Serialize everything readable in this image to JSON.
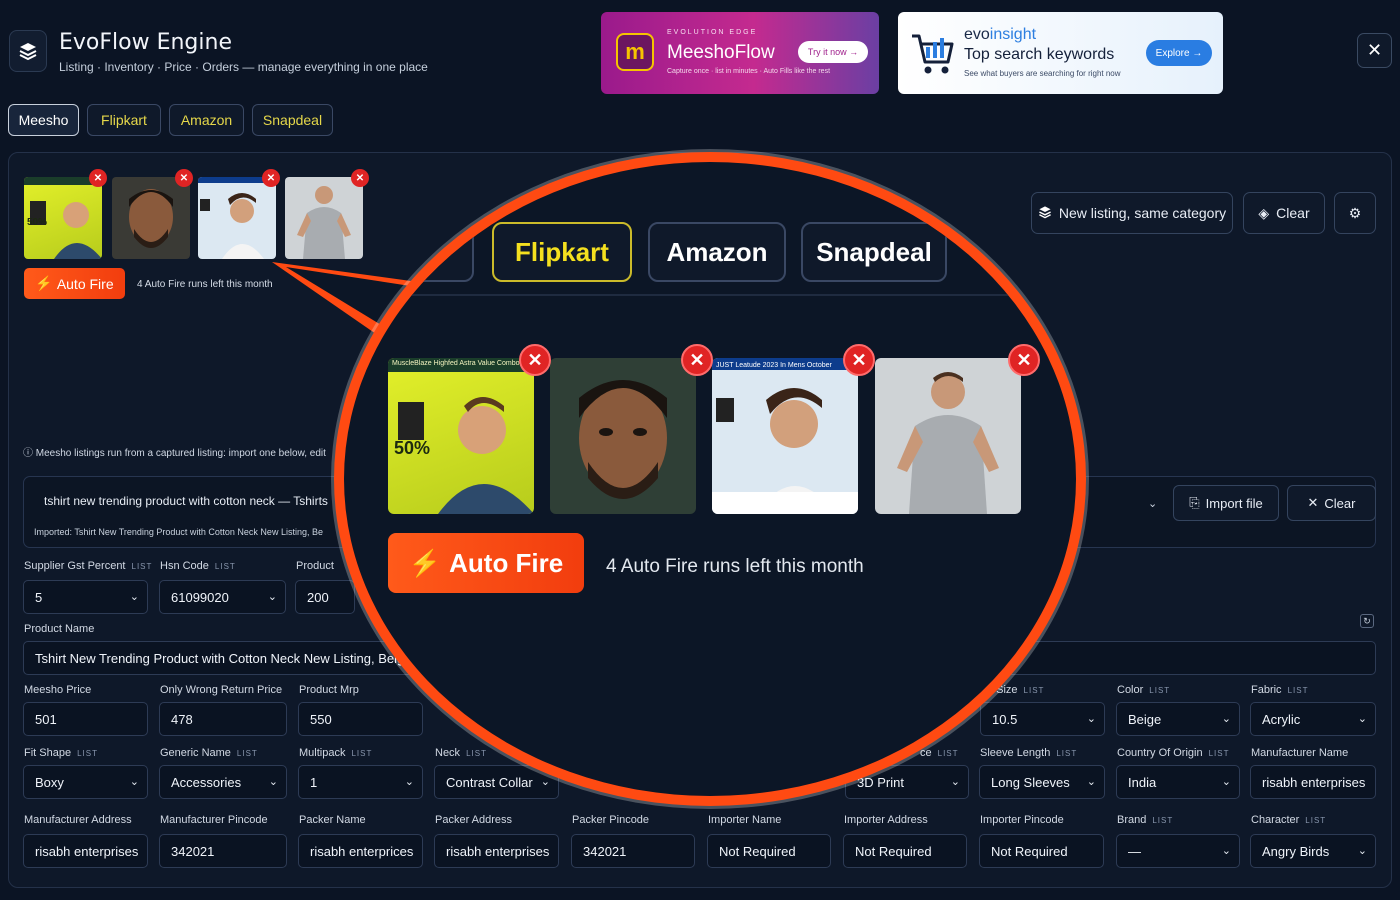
{
  "app": {
    "title": "EvoFlow Engine",
    "subtitle": "Listing · Inventory · Price · Orders — manage everything in one place"
  },
  "ads": [
    {
      "eyebrow": "EVOLUTION EDGE",
      "name": "MeeshoFlow",
      "tagline": "Capture once · list in minutes · Auto Fills like the rest",
      "cta": "Try it now →",
      "logo_letter": "m"
    },
    {
      "brand_a": "evo",
      "brand_b": "insight",
      "name": "Top search keywords",
      "tagline": "See what buyers are searching for right now",
      "cta": "Explore →"
    }
  ],
  "marketplace_tabs": [
    "Meesho",
    "Flipkart",
    "Amazon",
    "Snapdeal"
  ],
  "active_tab": "Meesho",
  "toolbar": {
    "new_listing": "New listing, same category",
    "clear": "Clear"
  },
  "auto_fire": {
    "label": "Auto Fire",
    "note": "4 Auto Fire runs left this month"
  },
  "info_line": "Meesho listings run from a captured listing: import one below, edit",
  "import": {
    "value": "tshirt new trending product with cotton neck — Tshirts",
    "note": "Imported: Tshirt New Trending Product with Cotton Neck New Listing, Be",
    "import_file": "Import file",
    "clear": "Clear"
  },
  "list_tag": "LIST",
  "fields_row1": [
    {
      "label": "Supplier Gst Percent",
      "list": true,
      "value": "5",
      "dropdown": true
    },
    {
      "label": "Hsn Code",
      "list": true,
      "value": "61099020",
      "dropdown": true
    },
    {
      "label": "Product",
      "list": false,
      "value": "200",
      "dropdown": false
    }
  ],
  "product_name": {
    "label": "Product Name",
    "value": "Tshirt New Trending Product with Cotton Neck New Listing, Beige"
  },
  "fields_row2": [
    {
      "label": "Meesho Price",
      "list": false,
      "value": "501",
      "dropdown": false
    },
    {
      "label": "Only Wrong Return Price",
      "list": false,
      "value": "478",
      "dropdown": false
    },
    {
      "label": "Product Mrp",
      "list": false,
      "value": "550",
      "dropdown": false
    },
    {
      "label": "t Size",
      "list": true,
      "value": "10.5",
      "dropdown": true
    },
    {
      "label": "Color",
      "list": true,
      "value": "Beige",
      "dropdown": true
    },
    {
      "label": "Fabric",
      "list": true,
      "value": "Acrylic",
      "dropdown": true
    }
  ],
  "fields_row3": [
    {
      "label": "Fit Shape",
      "list": true,
      "value": "Boxy",
      "dropdown": true
    },
    {
      "label": "Generic Name",
      "list": true,
      "value": "Accessories",
      "dropdown": true
    },
    {
      "label": "Multipack",
      "list": true,
      "value": "1",
      "dropdown": true
    },
    {
      "label": "Neck",
      "list": true,
      "value": "Contrast Collar",
      "dropdown": true
    },
    {
      "label": "ce",
      "list": true,
      "value": "3D Print",
      "dropdown": true
    },
    {
      "label": "Sleeve Length",
      "list": true,
      "value": "Long Sleeves",
      "dropdown": true
    },
    {
      "label": "Country Of Origin",
      "list": true,
      "value": "India",
      "dropdown": true
    },
    {
      "label": "Manufacturer Name",
      "list": false,
      "value": "risabh enterprises",
      "dropdown": false
    }
  ],
  "fields_row4": [
    {
      "label": "Manufacturer Address",
      "list": false,
      "value": "risabh enterprises",
      "dropdown": false
    },
    {
      "label": "Manufacturer Pincode",
      "list": false,
      "value": "342021",
      "dropdown": false
    },
    {
      "label": "Packer Name",
      "list": false,
      "value": "risabh enterprices",
      "dropdown": false
    },
    {
      "label": "Packer Address",
      "list": false,
      "value": "risabh enterprises",
      "dropdown": false
    },
    {
      "label": "Packer Pincode",
      "list": false,
      "value": "342021",
      "dropdown": false
    },
    {
      "label": "Importer Name",
      "list": false,
      "value": "Not Required",
      "dropdown": false
    },
    {
      "label": "Importer Address",
      "list": false,
      "value": "Not Required",
      "dropdown": false
    },
    {
      "label": "Importer Pincode",
      "list": false,
      "value": "Not Required",
      "dropdown": false
    },
    {
      "label": "Brand",
      "list": true,
      "value": "—",
      "dropdown": true
    },
    {
      "label": "Character",
      "list": true,
      "value": "Angry Birds",
      "dropdown": true
    }
  ],
  "thumb_texts": [
    "MuscleBlaze Highfed Astra Value Combo",
    "JUST Leatude 2023 In Mens October",
    "50%"
  ],
  "colors": {
    "accent": "#ff4a12",
    "tab_yellow": "#e6d84a",
    "background": "#0b1424"
  }
}
